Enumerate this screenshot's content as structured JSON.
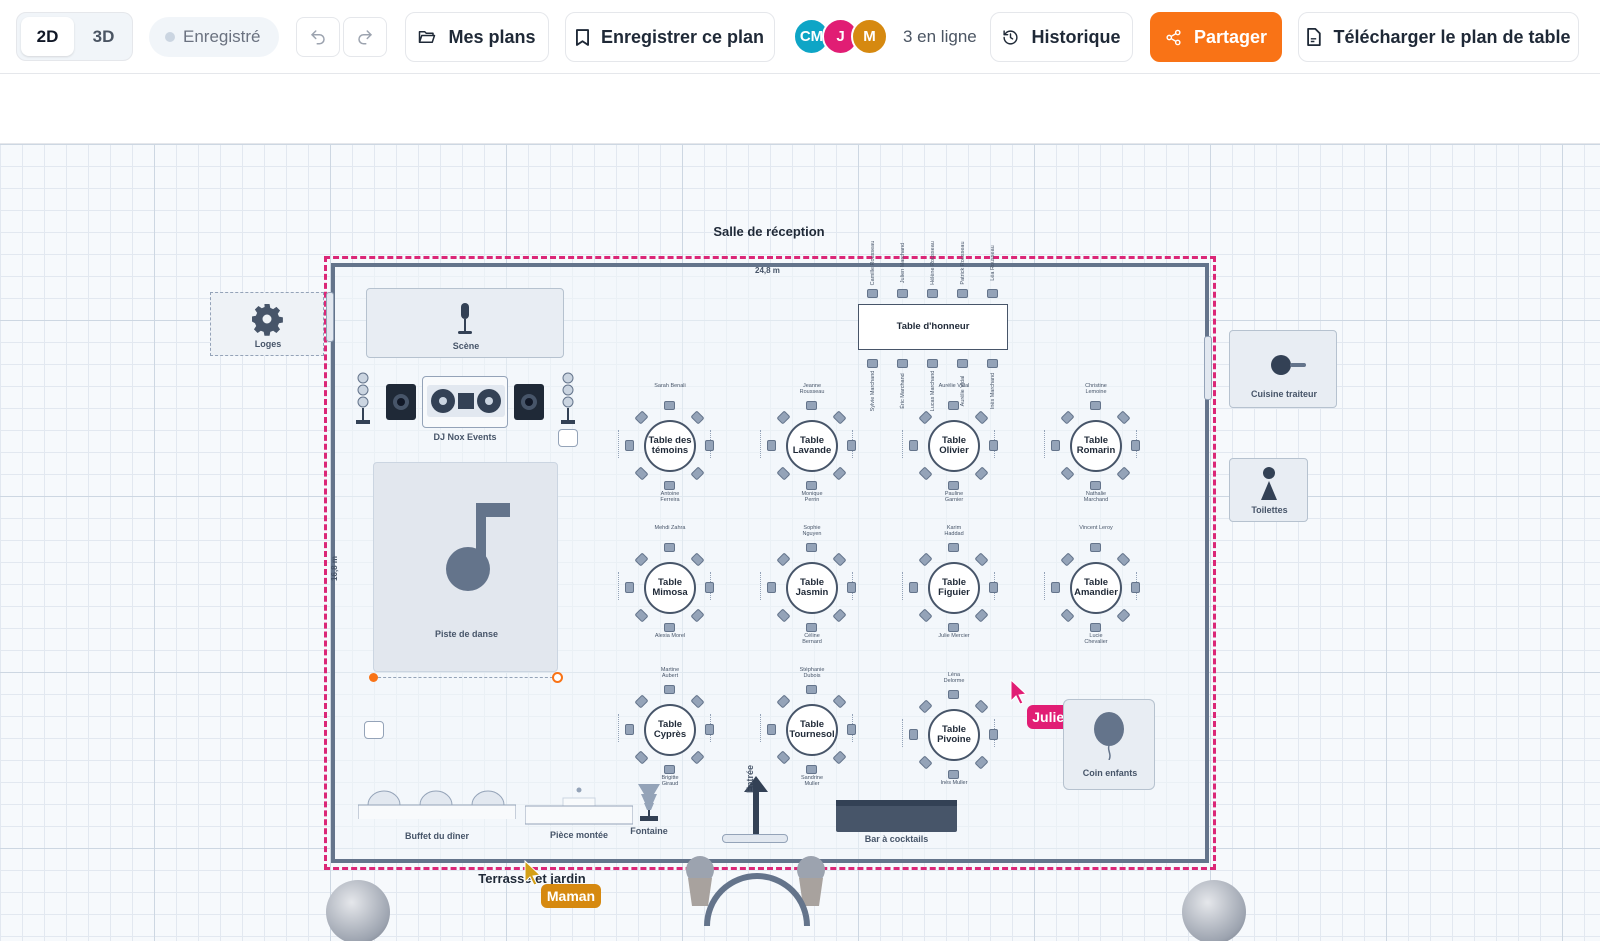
{
  "toolbar": {
    "view_2d": "2D",
    "view_3d": "3D",
    "saved_status": "Enregistré",
    "my_plans": "Mes plans",
    "save_plan": "Enregistrer ce plan",
    "avatars": [
      {
        "initials": "CM",
        "color": "#0ea5c6"
      },
      {
        "initials": "J",
        "color": "#e11d74"
      },
      {
        "initials": "M",
        "color": "#d68910"
      }
    ],
    "online": "3 en ligne",
    "history": "Historique",
    "share": "Partager",
    "download": "Télécharger le plan de table"
  },
  "plan": {
    "room_title": "Salle de réception",
    "width_dim": "24,8 m",
    "height_dim": "16,8 m",
    "loges": "Loges",
    "stage": "Scène",
    "dj": "DJ Nox Events",
    "dance_floor": "Piste de danse",
    "head_table": "Table d'honneur",
    "kitchen": "Cuisine traiteur",
    "toilets": "Toilettes",
    "kids_corner": "Coin enfants",
    "buffet": "Buffet du dîner",
    "cake": "Pièce montée",
    "fountain": "Fontaine",
    "entrance": "Entrée",
    "bar": "Bar à cocktails",
    "terrace": "Terrasse et jardin",
    "cursor_julien": "Julien",
    "cursor_maman": "Maman",
    "head_table_guests_top": [
      "Camille Rousseau",
      "Julien Marchand",
      "Hélène Rousseau",
      "Patrick Rousseau",
      "Léa Rousseau"
    ],
    "head_table_guests_bottom": [
      "Sylvie Marchand",
      "Éric Marchand",
      "Lucas Marchand",
      "Aurélie Vidal",
      "Inès Marchand"
    ],
    "tables": [
      {
        "line1": "Table des",
        "line2": "témoins",
        "top": "Sarah Benali",
        "bottom": "Antoine Ferreira"
      },
      {
        "line1": "Table",
        "line2": "Lavande",
        "top": "Jeanne Rousseau",
        "bottom": "Monique Perrin"
      },
      {
        "line1": "Table",
        "line2": "Olivier",
        "top": "Aurélie Vidal",
        "bottom": "Pauline Garnier"
      },
      {
        "line1": "Table",
        "line2": "Romarin",
        "top": "Christine Lemoine",
        "bottom": "Nathalie Marchand"
      },
      {
        "line1": "Table",
        "line2": "Mimosa",
        "top": "Mehdi Zahra",
        "bottom": "Alexia Morel"
      },
      {
        "line1": "Table",
        "line2": "Jasmin",
        "top": "Sophie Nguyen",
        "bottom": "Céline Bernard"
      },
      {
        "line1": "Table",
        "line2": "Figuier",
        "top": "Karim Haddad",
        "bottom": "Julie Mercier"
      },
      {
        "line1": "Table",
        "line2": "Amandier",
        "top": "Vincent Leroy",
        "bottom": "Lucie Chevalier"
      },
      {
        "line1": "Table",
        "line2": "Cyprès",
        "top": "Martine Aubert",
        "bottom": "Brigitte Giraud"
      },
      {
        "line1": "Table",
        "line2": "Tournesol",
        "top": "Stéphanie Dubois",
        "bottom": "Sandrine Muller"
      },
      {
        "line1": "Table",
        "line2": "Pivoine",
        "top": "Léna Delorme",
        "bottom": "Inès Muller"
      }
    ]
  }
}
